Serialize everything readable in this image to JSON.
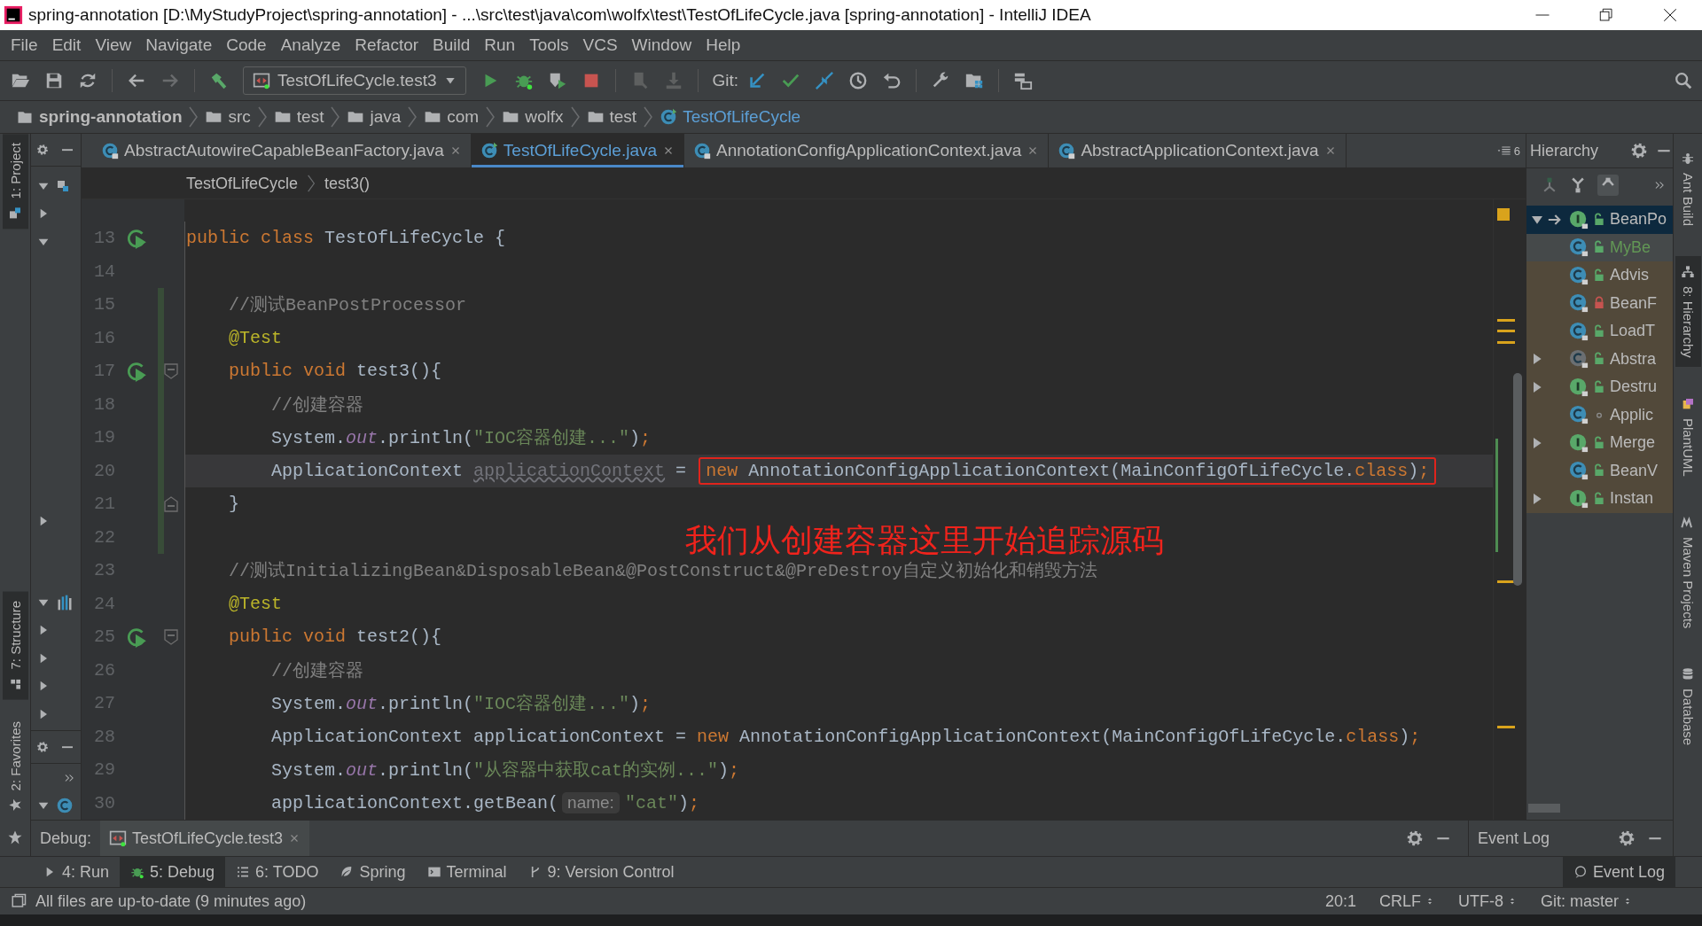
{
  "window": {
    "title": "spring-annotation [D:\\MyStudyProject\\spring-annotation] - ...\\src\\test\\java\\com\\wolfx\\test\\TestOfLifeCycle.java [spring-annotation] - IntelliJ IDEA"
  },
  "menu": [
    "File",
    "Edit",
    "View",
    "Navigate",
    "Code",
    "Analyze",
    "Refactor",
    "Build",
    "Run",
    "Tools",
    "VCS",
    "Window",
    "Help"
  ],
  "toolbar": {
    "run_config": "TestOfLifeCycle.test3",
    "git_label": "Git:"
  },
  "breadcrumb": [
    {
      "label": "spring-annotation",
      "kind": "project"
    },
    {
      "label": "src",
      "kind": "folder"
    },
    {
      "label": "test",
      "kind": "folder"
    },
    {
      "label": "java",
      "kind": "source"
    },
    {
      "label": "com",
      "kind": "package"
    },
    {
      "label": "wolfx",
      "kind": "package"
    },
    {
      "label": "test",
      "kind": "package"
    },
    {
      "label": "TestOfLifeCycle",
      "kind": "class"
    }
  ],
  "left_strip": [
    {
      "label": "1: Project",
      "selected": true,
      "kind": "project"
    },
    {
      "label": "7: Structure",
      "selected": true,
      "kind": "structure"
    },
    {
      "label": "2: Favorites",
      "selected": false,
      "kind": "favorites"
    }
  ],
  "project_panel": {
    "arrows": [
      {
        "kind": "arrow",
        "expanded": true
      },
      {
        "kind": "arrow",
        "expanded": false
      },
      {
        "kind": "arrow",
        "expanded": true
      },
      {
        "kind": "gap"
      },
      {
        "kind": "gap"
      },
      {
        "kind": "gap"
      },
      {
        "kind": "gap"
      },
      {
        "kind": "gap"
      },
      {
        "kind": "gap"
      },
      {
        "kind": "gap"
      },
      {
        "kind": "gap"
      },
      {
        "kind": "gap"
      },
      {
        "kind": "arrow",
        "expanded": false
      }
    ]
  },
  "structure_panel": {
    "arrows": [
      {
        "kind": "arrow",
        "expanded": true
      },
      {
        "kind": "arrow",
        "expanded": false
      },
      {
        "kind": "arrow",
        "expanded": false
      },
      {
        "kind": "arrow",
        "expanded": false
      },
      {
        "kind": "arrow",
        "expanded": false
      }
    ]
  },
  "favorites_panel": {
    "arrows": [
      {
        "kind": "arrow",
        "expanded": true
      }
    ]
  },
  "tabs": [
    {
      "label": "AbstractAutowireCapableBeanFactory.java",
      "selected": false,
      "locked": true
    },
    {
      "label": "TestOfLifeCycle.java",
      "selected": true,
      "locked": false
    },
    {
      "label": "AnnotationConfigApplicationContext.java",
      "selected": false,
      "locked": true
    },
    {
      "label": "AbstractApplicationContext.java",
      "selected": false,
      "locked": true
    }
  ],
  "tab_count": "6",
  "editor_breadcrumb": [
    "TestOfLifeCycle",
    "test3()"
  ],
  "code": [
    {
      "number": "13",
      "run": true,
      "fold_start": false,
      "fold_end": false,
      "changed": false,
      "current": false,
      "segments": [
        {
          "kind": "keyword",
          "text": "public class "
        },
        {
          "kind": "plain",
          "text": "TestOfLifeCycle {"
        }
      ]
    },
    {
      "number": "14",
      "run": false,
      "fold_start": false,
      "fold_end": false,
      "changed": false,
      "current": false
    },
    {
      "number": "15",
      "run": false,
      "fold_start": false,
      "fold_end": false,
      "changed": true,
      "current": false,
      "segments": [
        {
          "kind": "comment",
          "text": "    //测试BeanPostProcessor"
        }
      ]
    },
    {
      "number": "16",
      "run": false,
      "fold_start": false,
      "fold_end": false,
      "changed": true,
      "current": false,
      "segments": [
        {
          "kind": "annotation",
          "text": "    @Test"
        }
      ]
    },
    {
      "number": "17",
      "run": true,
      "fold_start": true,
      "fold_end": false,
      "changed": true,
      "current": false,
      "segments": [
        {
          "kind": "keyword",
          "text": "    public void "
        },
        {
          "kind": "plain",
          "text": "test3(){"
        }
      ]
    },
    {
      "number": "18",
      "run": false,
      "fold_start": false,
      "fold_end": false,
      "changed": true,
      "current": false,
      "segments": [
        {
          "kind": "comment",
          "text": "        //创建容器"
        }
      ]
    },
    {
      "number": "19",
      "run": false,
      "fold_start": false,
      "fold_end": false,
      "changed": true,
      "current": false,
      "segments": [
        {
          "kind": "plain",
          "text": "        System."
        },
        {
          "kind": "field",
          "text": "out"
        },
        {
          "kind": "plain",
          "text": ".println("
        },
        {
          "kind": "string",
          "text": "\"IOC容器创建...\""
        },
        {
          "kind": "plain",
          "text": ")"
        },
        {
          "kind": "keyword",
          "text": ";"
        }
      ]
    },
    {
      "number": "20",
      "run": false,
      "fold_start": false,
      "fold_end": false,
      "changed": true,
      "current": true,
      "segments": [
        {
          "kind": "plain",
          "text": "        ApplicationContext "
        },
        {
          "kind": "unused",
          "text": "applicationContext"
        },
        {
          "kind": "plain",
          "text": " = "
        }
      ],
      "boxed": [
        {
          "kind": "keyword",
          "text": "new "
        },
        {
          "kind": "plain",
          "text": "AnnotationConfigApplicationContext(MainConfigOfLifeCycle."
        },
        {
          "kind": "keyword",
          "text": "class"
        },
        {
          "kind": "plain",
          "text": ")"
        },
        {
          "kind": "keyword",
          "text": ";"
        }
      ]
    },
    {
      "number": "21",
      "run": false,
      "fold_start": false,
      "fold_end": true,
      "changed": true,
      "current": false,
      "segments": [
        {
          "kind": "plain",
          "text": "    }"
        }
      ]
    },
    {
      "number": "22",
      "run": false,
      "fold_start": false,
      "fold_end": false,
      "changed": true,
      "current": false
    },
    {
      "number": "23",
      "run": false,
      "fold_start": false,
      "fold_end": false,
      "changed": false,
      "current": false,
      "segments": [
        {
          "kind": "comment",
          "text": "    //测试InitializingBean&DisposableBean&@PostConstruct&@PreDestroy自定义初始化和销毁方法"
        }
      ]
    },
    {
      "number": "24",
      "run": false,
      "fold_start": false,
      "fold_end": false,
      "changed": false,
      "current": false,
      "segments": [
        {
          "kind": "annotation",
          "text": "    @Test"
        }
      ]
    },
    {
      "number": "25",
      "run": true,
      "fold_start": true,
      "fold_end": false,
      "changed": false,
      "current": false,
      "segments": [
        {
          "kind": "keyword",
          "text": "    public void "
        },
        {
          "kind": "plain",
          "text": "test2(){"
        }
      ]
    },
    {
      "number": "26",
      "run": false,
      "fold_start": false,
      "fold_end": false,
      "changed": false,
      "current": false,
      "segments": [
        {
          "kind": "comment",
          "text": "        //创建容器"
        }
      ]
    },
    {
      "number": "27",
      "run": false,
      "fold_start": false,
      "fold_end": false,
      "changed": false,
      "current": false,
      "segments": [
        {
          "kind": "plain",
          "text": "        System."
        },
        {
          "kind": "field",
          "text": "out"
        },
        {
          "kind": "plain",
          "text": ".println("
        },
        {
          "kind": "string",
          "text": "\"IOC容器创建...\""
        },
        {
          "kind": "plain",
          "text": ")"
        },
        {
          "kind": "keyword",
          "text": ";"
        }
      ]
    },
    {
      "number": "28",
      "run": false,
      "fold_start": false,
      "fold_end": false,
      "changed": false,
      "current": false,
      "segments": [
        {
          "kind": "plain",
          "text": "        ApplicationContext applicationContext = "
        },
        {
          "kind": "keyword",
          "text": "new "
        },
        {
          "kind": "plain",
          "text": "AnnotationConfigApplicationContext(MainConfigOfLifeCycle."
        },
        {
          "kind": "keyword",
          "text": "class"
        },
        {
          "kind": "plain",
          "text": ")"
        },
        {
          "kind": "keyword",
          "text": ";"
        }
      ]
    },
    {
      "number": "29",
      "run": false,
      "fold_start": false,
      "fold_end": false,
      "changed": false,
      "current": false,
      "segments": [
        {
          "kind": "plain",
          "text": "        System."
        },
        {
          "kind": "field",
          "text": "out"
        },
        {
          "kind": "plain",
          "text": ".println("
        },
        {
          "kind": "string",
          "text": "\"从容器中获取cat的实例...\""
        },
        {
          "kind": "plain",
          "text": ")"
        },
        {
          "kind": "keyword",
          "text": ";"
        }
      ]
    },
    {
      "number": "30",
      "run": false,
      "fold_start": false,
      "fold_end": false,
      "changed": false,
      "current": false,
      "segments": [
        {
          "kind": "plain",
          "text": "        applicationContext.getBean("
        },
        {
          "kind": "hint",
          "text": "name:"
        },
        {
          "kind": "string",
          "text": "\"cat\""
        },
        {
          "kind": "plain",
          "text": ")"
        },
        {
          "kind": "keyword",
          "text": ";"
        }
      ]
    }
  ],
  "annotation_note": "我们从创建容器这里开始追踪源码",
  "hierarchy": {
    "title": "Hierarchy",
    "items": [
      {
        "label": "BeanPo",
        "kind": "interface",
        "locked": false,
        "package_access": false,
        "expandable": true,
        "expanded": true,
        "selected": true,
        "current": false,
        "library": false
      },
      {
        "label": "MyBe",
        "kind": "class",
        "locked": false,
        "package_access": false,
        "expandable": false,
        "selected": false,
        "current": true,
        "library": false
      },
      {
        "label": "Advis",
        "kind": "class",
        "locked": false,
        "package_access": false,
        "expandable": false,
        "selected": false,
        "current": false,
        "library": true
      },
      {
        "label": "BeanF",
        "kind": "class",
        "locked": true,
        "package_access": false,
        "expandable": false,
        "selected": false,
        "current": false,
        "library": true
      },
      {
        "label": "LoadT",
        "kind": "class",
        "locked": false,
        "package_access": false,
        "expandable": false,
        "selected": false,
        "current": false,
        "library": true
      },
      {
        "label": "Abstra",
        "kind": "abstract",
        "locked": false,
        "package_access": false,
        "expandable": true,
        "expanded": false,
        "selected": false,
        "current": false,
        "library": true
      },
      {
        "label": "Destru",
        "kind": "interface",
        "locked": false,
        "package_access": false,
        "expandable": true,
        "expanded": false,
        "selected": false,
        "current": false,
        "library": true
      },
      {
        "label": "Applic",
        "kind": "class",
        "locked": false,
        "package_access": true,
        "expandable": false,
        "selected": false,
        "current": false,
        "library": true
      },
      {
        "label": "Merge",
        "kind": "interface",
        "locked": false,
        "package_access": false,
        "expandable": true,
        "expanded": false,
        "selected": false,
        "current": false,
        "library": true
      },
      {
        "label": "BeanV",
        "kind": "class",
        "locked": false,
        "package_access": false,
        "expandable": false,
        "selected": false,
        "current": false,
        "library": true
      },
      {
        "label": "Instan",
        "kind": "interface",
        "locked": false,
        "package_access": false,
        "expandable": true,
        "expanded": false,
        "selected": false,
        "current": false,
        "library": true
      }
    ]
  },
  "right_strip": [
    {
      "label": "Ant Build",
      "selected": false,
      "kind": "ant"
    },
    {
      "label": "8: Hierarchy",
      "selected": true,
      "kind": "hierarchy"
    },
    {
      "label": "PlantUML",
      "selected": false,
      "kind": "plantuml"
    },
    {
      "label": "Maven Projects",
      "selected": false,
      "kind": "maven"
    },
    {
      "label": "Database",
      "selected": false,
      "kind": "database"
    }
  ],
  "debug_bar": {
    "label": "Debug:",
    "session": "TestOfLifeCycle.test3",
    "event_log_title": "Event Log"
  },
  "tool_tabs": [
    {
      "label": "4: Run",
      "kind": "run",
      "selected": false
    },
    {
      "label": "5: Debug",
      "kind": "debug",
      "selected": true
    },
    {
      "label": "6: TODO",
      "kind": "todo",
      "selected": false
    },
    {
      "label": "Spring",
      "kind": "spring",
      "selected": false
    },
    {
      "label": "Terminal",
      "kind": "terminal",
      "selected": false
    },
    {
      "label": "9: Version Control",
      "kind": "vcs",
      "selected": false
    }
  ],
  "event_log_button": "Event Log",
  "status_bar": {
    "message": "All files are up-to-date (9 minutes ago)",
    "position": "20:1",
    "line_separator": "CRLF",
    "encoding": "UTF-8",
    "vcs": "Git: master"
  }
}
